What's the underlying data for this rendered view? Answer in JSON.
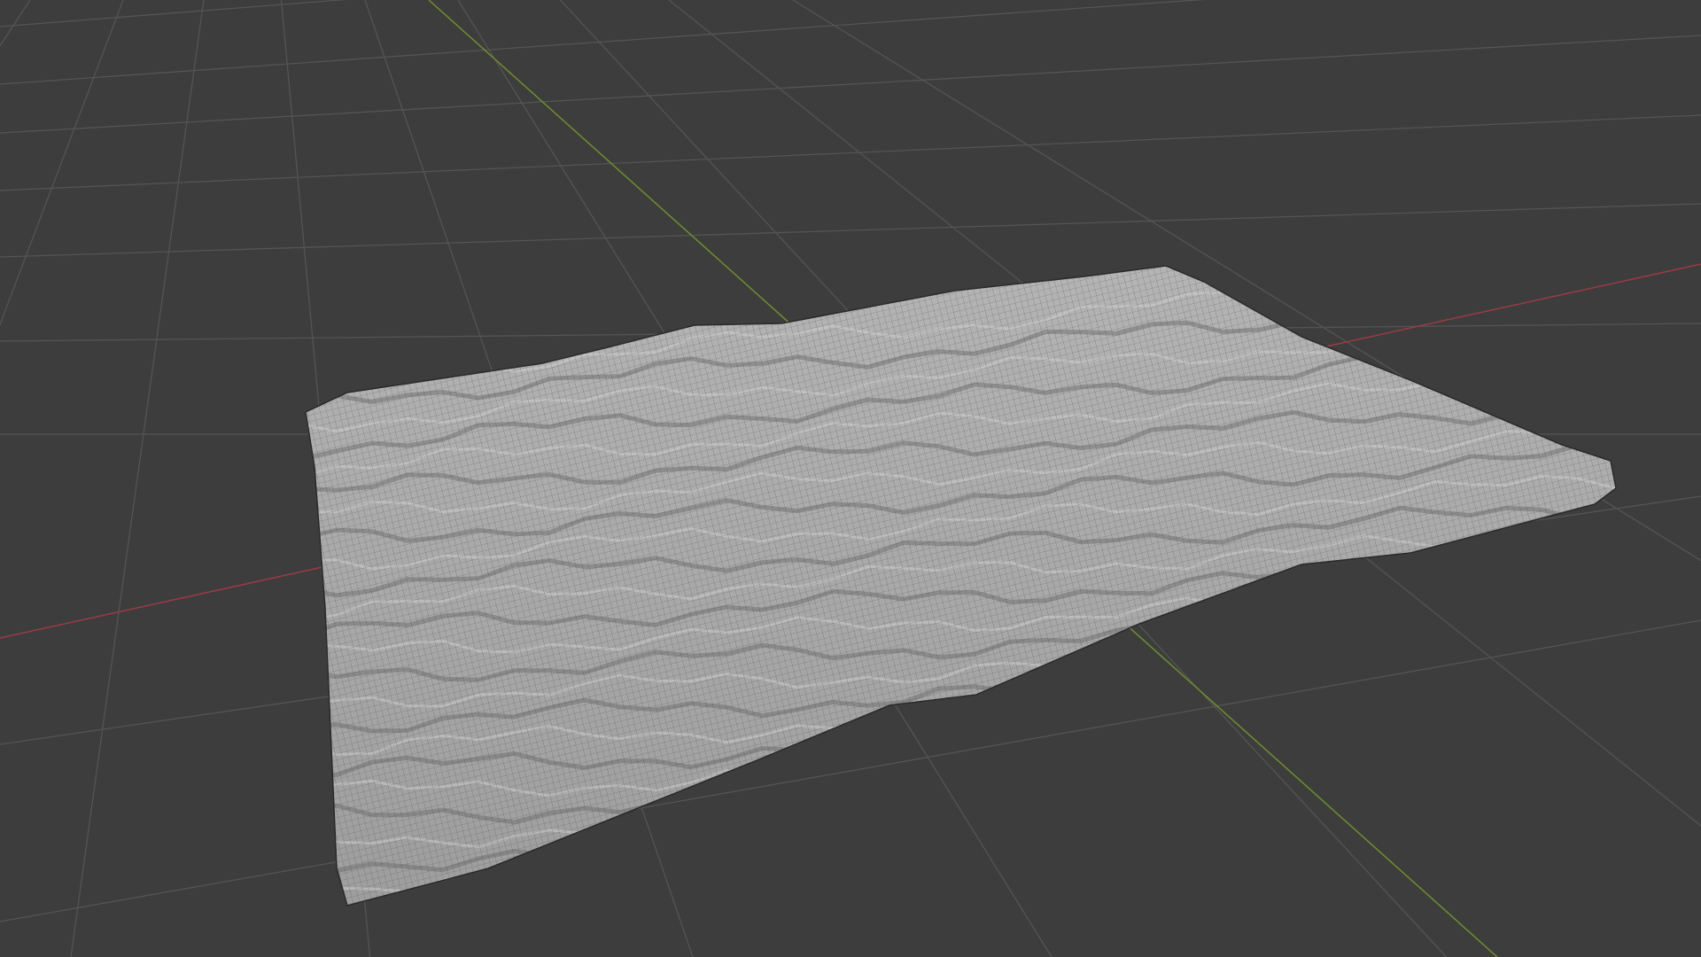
{
  "viewport": {
    "background": "#3d3d3d",
    "grid_color": "#545454",
    "x_axis_color": "#9a3b45",
    "y_axis_color": "#6f8f2a",
    "mesh_fill": "#a9a9a9",
    "wire_color": "#3a3a3a"
  }
}
